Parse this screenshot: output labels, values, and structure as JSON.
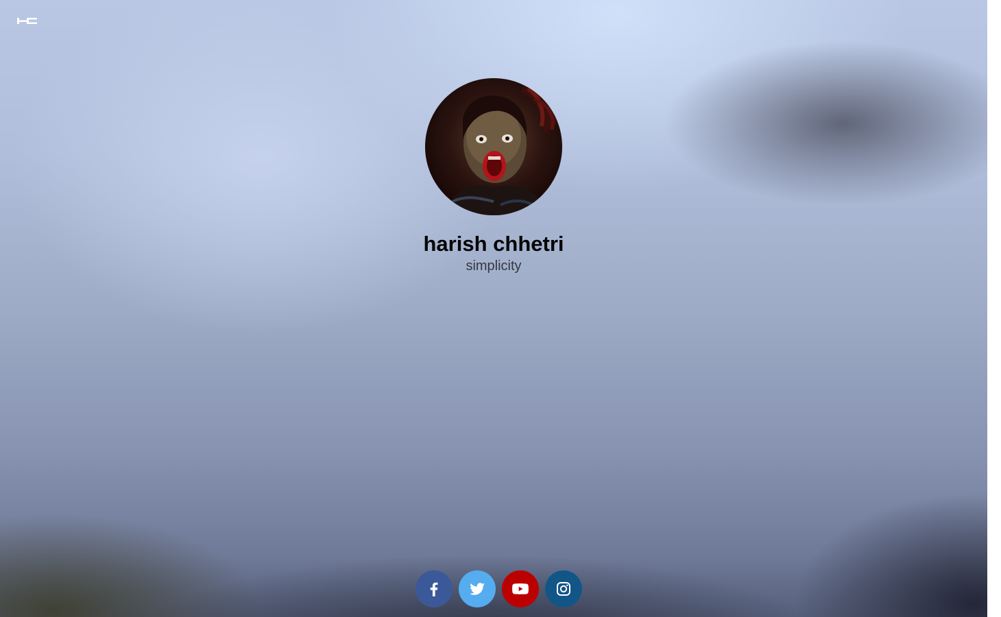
{
  "profile": {
    "name": "harish chhetri",
    "tagline": "simplicity"
  },
  "logo": {
    "icon": "hc-monogram-icon"
  },
  "socials": [
    {
      "name": "facebook",
      "icon": "facebook-icon",
      "color": "#3b5998"
    },
    {
      "name": "twitter",
      "icon": "twitter-icon",
      "color": "#55acee"
    },
    {
      "name": "youtube",
      "icon": "youtube-icon",
      "color": "#bb0000"
    },
    {
      "name": "instagram",
      "icon": "instagram-icon",
      "color": "#125688"
    }
  ],
  "colors": {
    "name_text": "#050505",
    "tagline_text": "#333842"
  }
}
